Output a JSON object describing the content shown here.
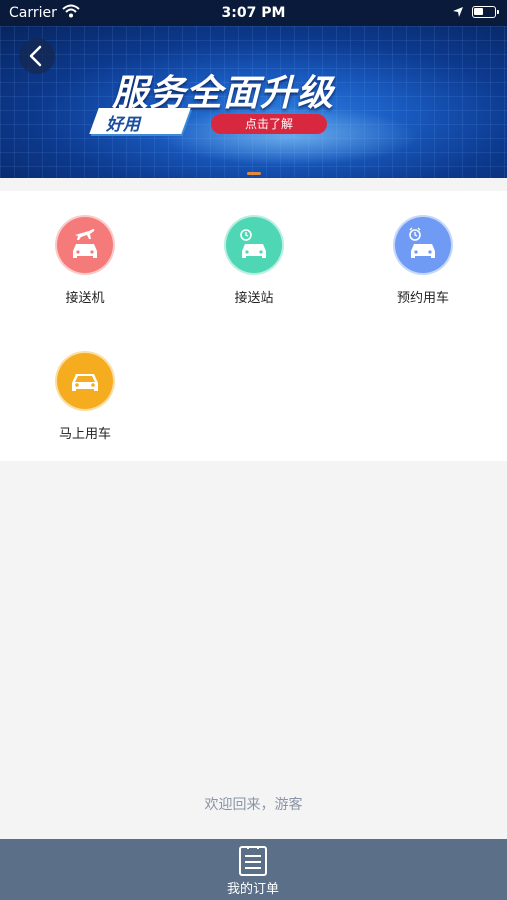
{
  "status_bar": {
    "carrier": "Carrier",
    "time": "3:07 PM"
  },
  "banner": {
    "headline": "服务全面升级",
    "ribbon": "好用",
    "cta": "点击了解"
  },
  "services": [
    {
      "label": "接送机",
      "color": "#f57b7b",
      "icon": "plane-car-icon"
    },
    {
      "label": "接送站",
      "color": "#4fd6b4",
      "icon": "station-car-icon"
    },
    {
      "label": "预约用车",
      "color": "#6f9bf5",
      "icon": "clock-car-icon"
    },
    {
      "label": "马上用车",
      "color": "#f5ad1f",
      "icon": "car-icon"
    }
  ],
  "welcome": "欢迎回来，游客",
  "tab_bar": {
    "orders_label": "我的订单"
  }
}
